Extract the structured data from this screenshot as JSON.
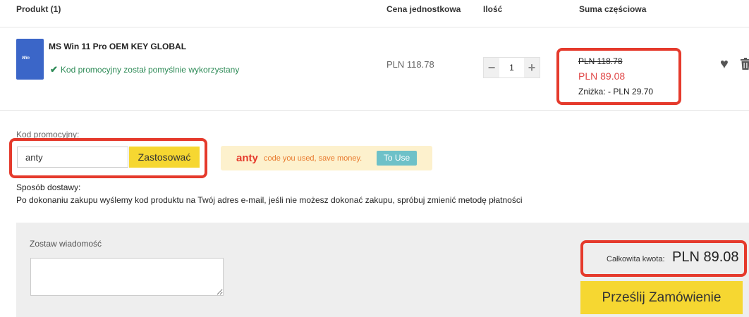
{
  "table": {
    "headers": {
      "product": "Produkt (1)",
      "unit_price": "Cena jednostkowa",
      "quantity": "Ilość",
      "subtotal": "Suma częściowa"
    }
  },
  "item": {
    "thumb_text": "Win",
    "name": "MS Win 11 Pro OEM KEY GLOBAL",
    "promo_status": "Kod promocyjny został pomyślnie wykorzystany",
    "unit_price": "PLN 118.78",
    "quantity": "1",
    "quantity_minus": "−",
    "quantity_plus": "+",
    "old_price": "PLN 118.78",
    "new_price": "PLN 89.08",
    "discount": "Zniżka: - PLN 29.70"
  },
  "promo": {
    "label": "Kod promocyjny:",
    "input_value": "anty",
    "apply_label": "Zastosować",
    "banner_code": "anty",
    "banner_text": "code you used, save money.",
    "banner_button": "To Use"
  },
  "shipping": {
    "label": "Sposób dostawy:",
    "info": "Po dokonaniu zakupu wyślemy kod produktu na Twój adres e-mail, jeśli nie możesz dokonać zakupu, spróbuj zmienić metodę płatności"
  },
  "message": {
    "label": "Zostaw wiadomość"
  },
  "total": {
    "label": "Całkowita kwota:",
    "value": "PLN 89.08",
    "submit_label": "Prześlij Zamówienie"
  },
  "colors": {
    "accent_yellow": "#f6d731",
    "highlight_red": "#e53a2c",
    "success_green": "#2e8b57",
    "use_button": "#6ec1c8"
  }
}
